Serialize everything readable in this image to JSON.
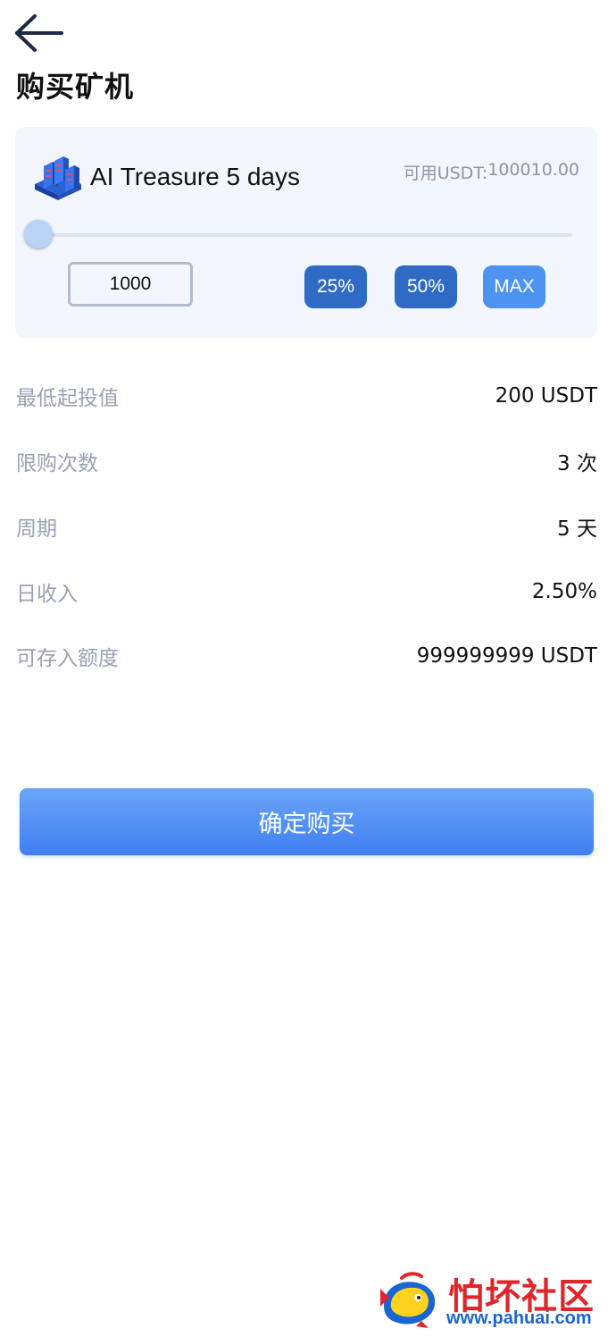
{
  "header": {
    "title": "购买矿机",
    "back_icon": "arrow-left-icon"
  },
  "product": {
    "icon": "server-rack-icon",
    "name": "AI Treasure 5 days",
    "available_label": "可用USDT:",
    "available_value": "100010.00"
  },
  "slider": {
    "level_percent": 0
  },
  "amount": {
    "value": "1000"
  },
  "quick_buttons": {
    "p25": "25%",
    "p50": "50%",
    "max": "MAX"
  },
  "details": [
    {
      "label": "最低起投值",
      "value": "200 USDT"
    },
    {
      "label": "限购次数",
      "value": "3 次"
    },
    {
      "label": "周期",
      "value": "5 天"
    },
    {
      "label": "日收入",
      "value": "2.50%"
    },
    {
      "label": "可存入额度",
      "value": "999999999 USDT"
    }
  ],
  "confirm_button": "确定购买",
  "watermark": {
    "title": "怕坏社区",
    "url": "www.pahuai.com"
  },
  "colors": {
    "accent": "#4d93f2",
    "button_dark": "#2f6bc4",
    "card_bg": "#f3f7fd",
    "label_grey": "#9aa1b4",
    "watermark_red": "#e0262b"
  }
}
